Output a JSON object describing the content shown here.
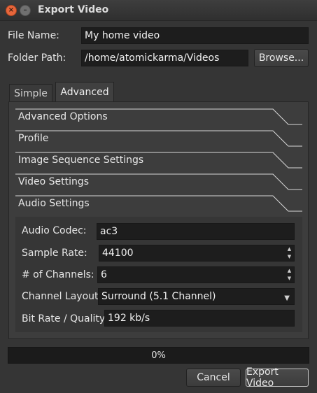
{
  "window": {
    "title": "Export Video",
    "close_glyph": "×",
    "minimize_glyph": "–"
  },
  "file_name": {
    "label": "File Name:",
    "value": "My home video"
  },
  "folder_path": {
    "label": "Folder Path:",
    "value": "/home/atomickarma/Videos",
    "browse_label": "Browse..."
  },
  "tabs": [
    {
      "label": "Simple",
      "active": false
    },
    {
      "label": "Advanced",
      "active": true
    }
  ],
  "sections": [
    {
      "label": "Advanced Options"
    },
    {
      "label": "Profile"
    },
    {
      "label": "Image Sequence Settings"
    },
    {
      "label": "Video Settings"
    },
    {
      "label": "Audio Settings"
    }
  ],
  "audio": {
    "codec": {
      "label": "Audio Codec:",
      "value": "ac3"
    },
    "sample_rate": {
      "label": "Sample Rate:",
      "value": "44100"
    },
    "channels": {
      "label": "# of Channels:",
      "value": "6"
    },
    "channel_layout": {
      "label": "Channel Layout:",
      "value": "Surround (5.1 Channel)"
    },
    "bit_rate": {
      "label": "Bit Rate / Quality:",
      "value": "192 kb/s"
    }
  },
  "progress": {
    "value": 0,
    "text": "0%"
  },
  "buttons": {
    "cancel": "Cancel",
    "export": "Export Video"
  },
  "glyphs": {
    "up": "▲",
    "down": "▼",
    "dropdown": "▼"
  },
  "colors": {
    "background": "#353535",
    "field": "#1d1d1d",
    "close_button": "#e8663b"
  }
}
